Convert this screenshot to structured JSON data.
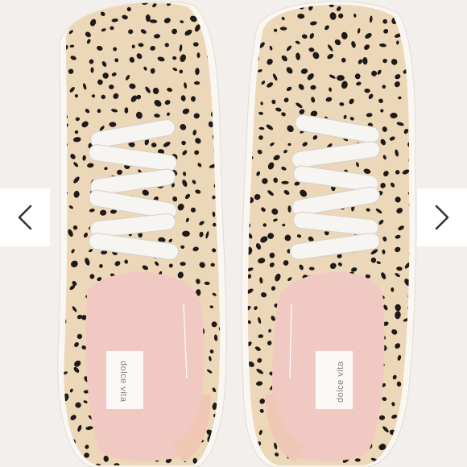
{
  "carousel": {
    "prev_icon": "chevron-left-icon",
    "next_icon": "chevron-right-icon"
  },
  "product": {
    "insole_brand_text": "dolce vita"
  },
  "colors": {
    "background": "#f2efec",
    "calf_hair": "#ecd7b9",
    "spots": "#1e1a17",
    "laces": "#f7f5f2",
    "insole": "#f0c9c2",
    "heel_tab": "#efc7b4",
    "nav_button": "#ffffff"
  }
}
